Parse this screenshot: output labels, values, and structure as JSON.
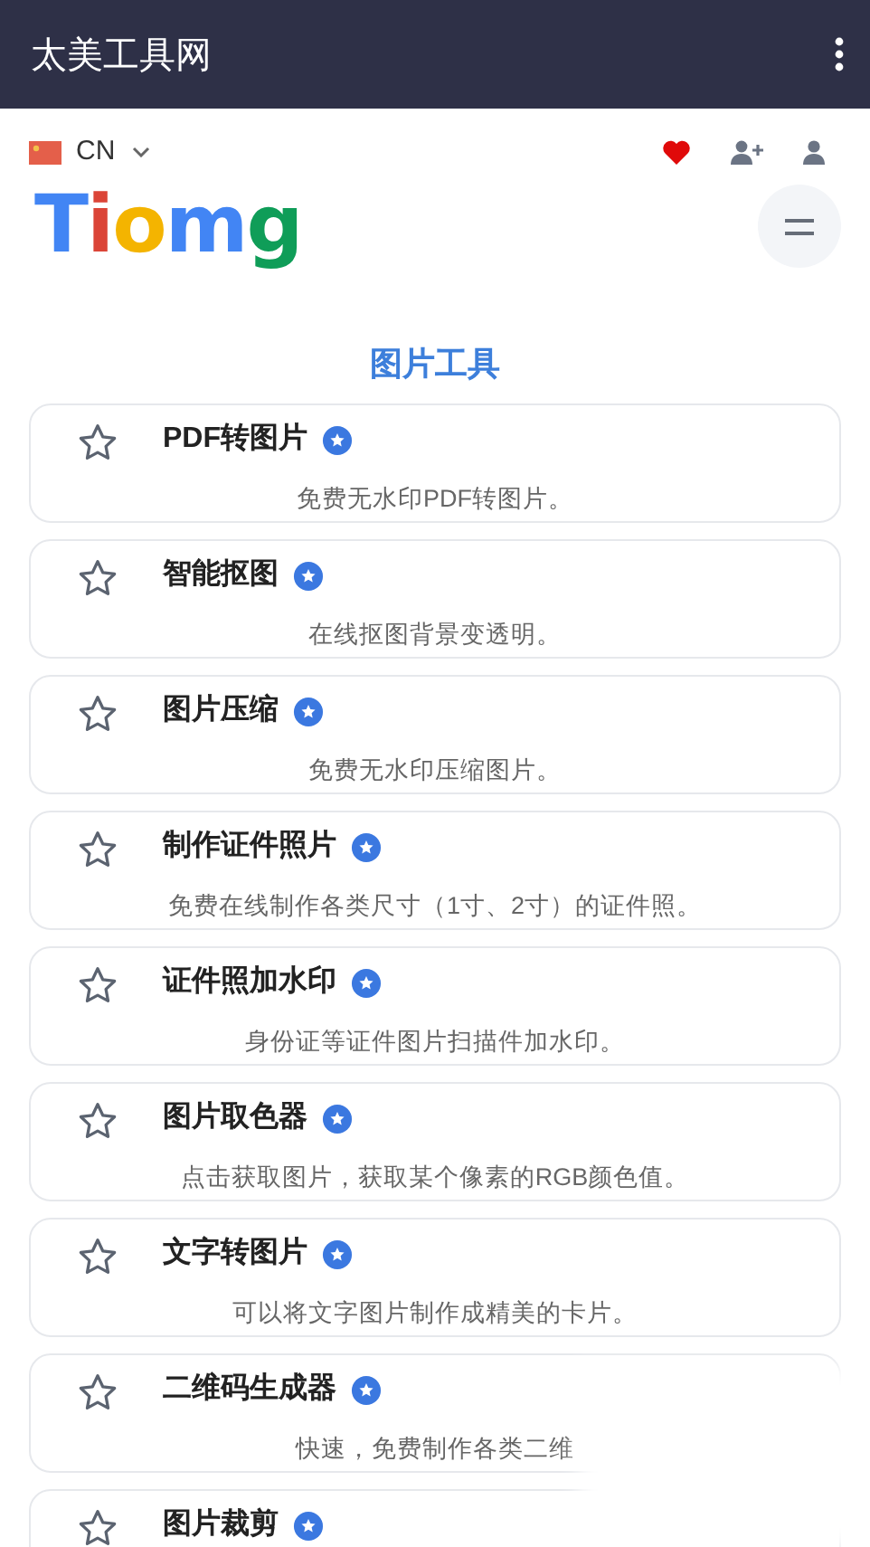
{
  "app_bar": {
    "title": "太美工具网"
  },
  "header": {
    "language": "CN",
    "logo": "Tiomg"
  },
  "section": {
    "title": "图片工具"
  },
  "tools": [
    {
      "title": "PDF转图片",
      "description": "免费无水印PDF转图片。"
    },
    {
      "title": "智能抠图",
      "description": "在线抠图背景变透明。"
    },
    {
      "title": "图片压缩",
      "description": "免费无水印压缩图片。"
    },
    {
      "title": "制作证件照片",
      "description": "免费在线制作各类尺寸（1寸、2寸）的证件照。"
    },
    {
      "title": "证件照加水印",
      "description": "身份证等证件图片扫描件加水印。"
    },
    {
      "title": "图片取色器",
      "description": "点击获取图片，获取某个像素的RGB颜色值。"
    },
    {
      "title": "文字转图片",
      "description": "可以将文字图片制作成精美的卡片。"
    },
    {
      "title": "二维码生成器",
      "description": "快速，免费制作各类二维"
    },
    {
      "title": "图片裁剪"
    }
  ]
}
